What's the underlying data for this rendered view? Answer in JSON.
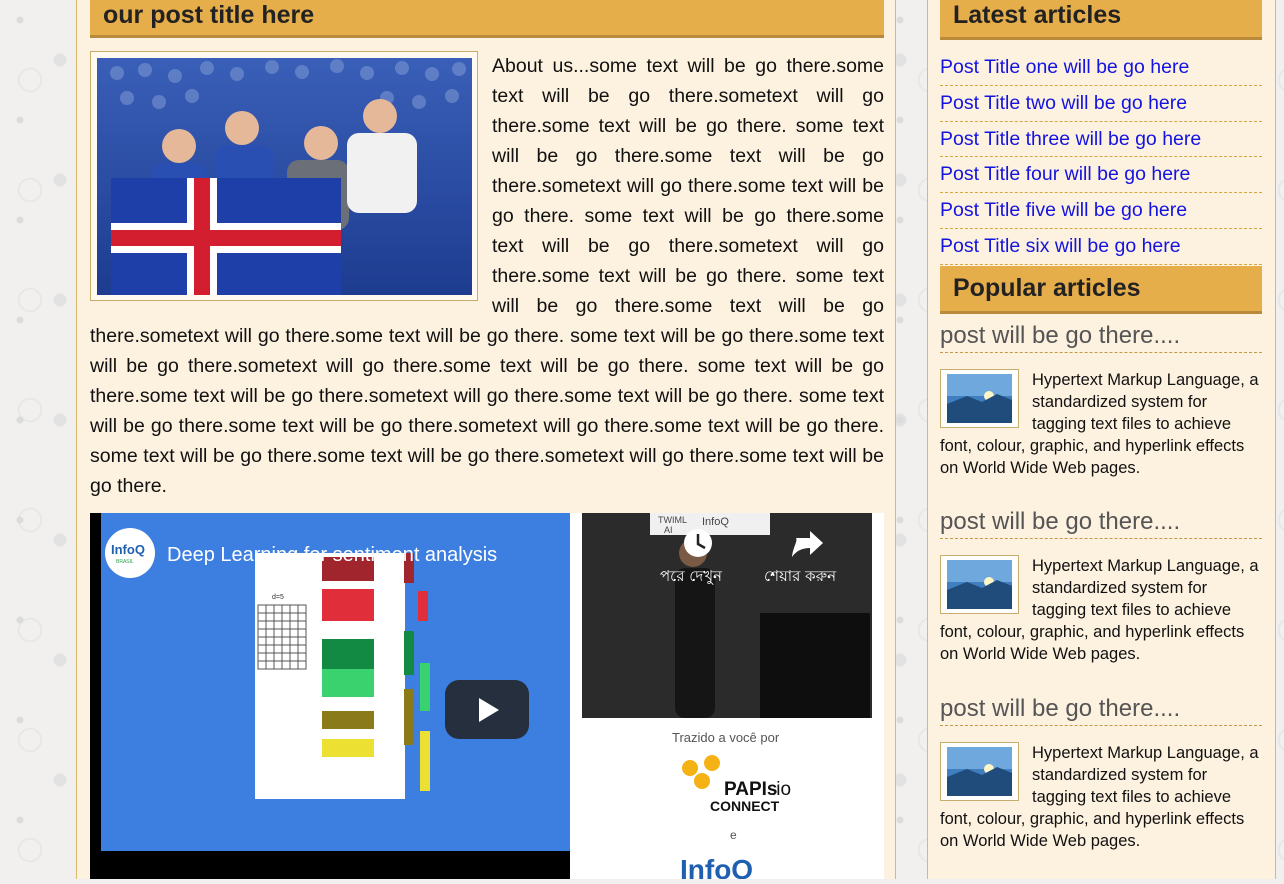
{
  "post": {
    "title": "our post title here",
    "body": "About us...some text will be go there.some text will be go there.sometext will go there.some text will be go there. some text will be go there.some text will be go there.sometext will go there.some text will be go there. some text will be go there.some text will be go there.sometext will go there.some text will be go there. some text will be go there.some text will be go there.sometext will go there.some text will be go there. some text will be go there.some text will be go there.sometext will go there.some text will be go there. some text will be go there.some text will be go there.sometext will go there.some text will be go there. some text will be go there.some text will be go there.sometext will go there.some text will be go there. some text will be go there.some text will be go there.sometext will go there.some text will be go there."
  },
  "video": {
    "channel_logo": "InfoQ",
    "channel_sub": "BRASIL",
    "title": "Deep Learning for sentiment analysis",
    "watch_later_label": "পরে দেখুন",
    "share_label": "শেয়ার করুন",
    "slide_board_label": "d=5",
    "stage_sign_1": "TWIML",
    "stage_sign_2": "AI",
    "stage_sign_3": "InfoQ",
    "brought_by": "Trazido a você por",
    "sponsor_1a": "PAPIs",
    "sponsor_1b": ".io",
    "sponsor_1c": "CONNECT",
    "connector": "e",
    "sponsor_2": "InfoQ",
    "play_icon": "play-icon",
    "clock_icon": "clock-icon",
    "share_icon": "share-arrow-icon"
  },
  "latest": {
    "heading": "Latest articles",
    "items": [
      "Post Title one will be go here",
      "Post Title two will be go here",
      "Post Title three will be go here",
      "Post Title four will be go here",
      "Post Title five will be go here",
      "Post Title six will be go here"
    ]
  },
  "popular": {
    "heading": "Popular articles",
    "items": [
      {
        "title": "post will be go there....",
        "text": "Hypertext Markup Language, a standardized system for tagging text files to achieve font, colour, graphic, and hyperlink effects on World Wide Web pages."
      },
      {
        "title": "post will be go there....",
        "text": "Hypertext Markup Language, a standardized system for tagging text files to achieve font, colour, graphic, and hyperlink effects on World Wide Web pages."
      },
      {
        "title": "post will be go there....",
        "text": "Hypertext Markup Language, a standardized system for tagging text files to achieve font, colour, graphic, and hyperlink effects on World Wide Web pages."
      }
    ]
  },
  "colors": {
    "header_bg": "#e6ad4b",
    "header_border": "#b98a3c",
    "panel_bg": "#fdf1df",
    "link": "#1414e0"
  }
}
